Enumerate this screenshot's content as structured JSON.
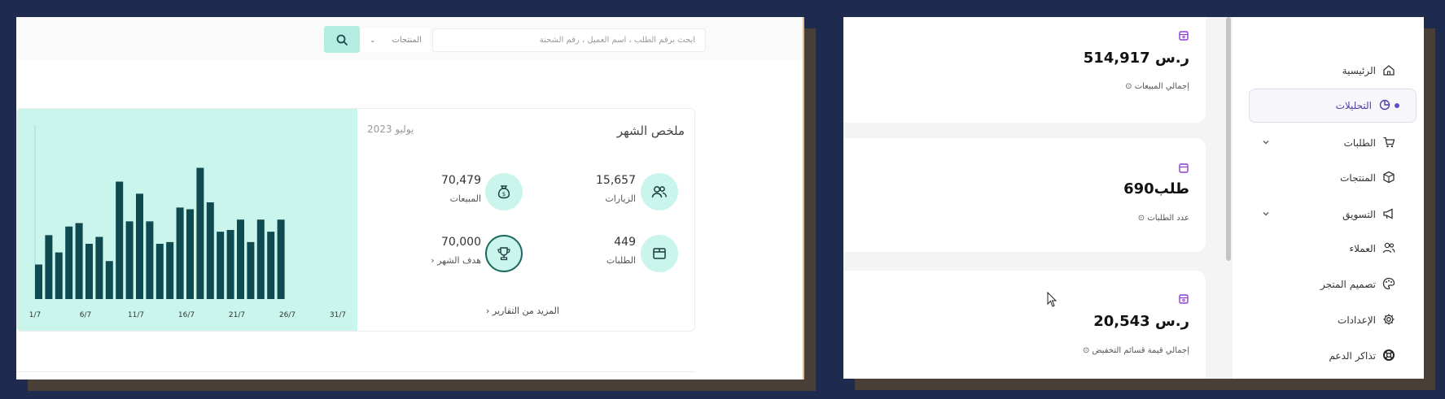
{
  "left_panel": {
    "search": {
      "placeholder": "ابحث برقم الطلب ، اسم العميل ، رقم الشحنة",
      "category_select": "المنتجات",
      "search_icon": "search-icon"
    },
    "summary": {
      "title": "ملخص الشهر",
      "date": "يوليو 2023",
      "stats": [
        {
          "label": "الزيارات",
          "value": "15,657",
          "icon": "users-icon"
        },
        {
          "label": "المبيعات",
          "value": "70,479",
          "icon": "money-bag-icon"
        },
        {
          "label": "الطلبات",
          "value": "449",
          "icon": "box-icon"
        },
        {
          "label": "هدف الشهر",
          "value": "70,000",
          "icon": "trophy-icon"
        }
      ],
      "more_reports": "المزيد من التقارير"
    },
    "chart_data": {
      "type": "bar",
      "x_tick_labels": [
        "1/7",
        "6/7",
        "11/7",
        "16/7",
        "21/7",
        "26/7",
        "31/7"
      ],
      "values": [
        20,
        37,
        27,
        42,
        44,
        32,
        36,
        22,
        68,
        45,
        61,
        45,
        32,
        33,
        53,
        52,
        76,
        56,
        39,
        40,
        46,
        33,
        46,
        39,
        46
      ],
      "color": "#0e4a4f",
      "background": "#c9f5ec",
      "ylim": [
        0,
        80
      ]
    }
  },
  "right_panel": {
    "kpis": [
      {
        "value": "514,917 ر.س",
        "label": "إجمالي المبيعات",
        "icon": "box-purple-icon"
      },
      {
        "value": "690طلب",
        "label": "عدد الطلبات",
        "icon": "box-purple-icon"
      },
      {
        "value": "20,543 ر.س",
        "label": "إجمالي قيمة قسائم التخفيض",
        "icon": "box-purple-icon"
      }
    ],
    "sidebar": {
      "items": [
        {
          "label": "الرئيسية",
          "icon": "home-icon",
          "has_chevron": false,
          "active": false
        },
        {
          "label": "التحليلات",
          "icon": "analytics-icon",
          "has_chevron": false,
          "active": true
        },
        {
          "label": "الطلبات",
          "icon": "cart-icon",
          "has_chevron": true,
          "active": false
        },
        {
          "label": "المنتجات",
          "icon": "box-icon",
          "has_chevron": false,
          "active": false
        },
        {
          "label": "التسويق",
          "icon": "megaphone-icon",
          "has_chevron": true,
          "active": false
        },
        {
          "label": "العملاء",
          "icon": "users-icon",
          "has_chevron": false,
          "active": false
        },
        {
          "label": "تصميم المتجر",
          "icon": "palette-icon",
          "has_chevron": false,
          "active": false
        },
        {
          "label": "الإعدادات",
          "icon": "gear-icon",
          "has_chevron": false,
          "active": false
        },
        {
          "label": "تذاكر الدعم",
          "icon": "lifebuoy-icon",
          "has_chevron": false,
          "active": false
        }
      ]
    }
  },
  "colors": {
    "background": "#1e2a4e",
    "mint": "#c9f5ec",
    "bar": "#0e4a4f",
    "accent_purple": "#5b4fc7"
  }
}
